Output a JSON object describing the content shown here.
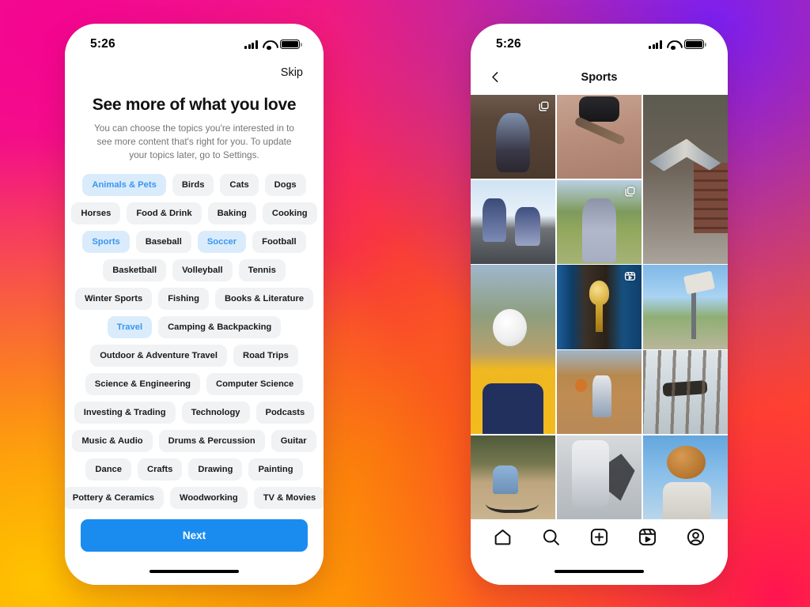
{
  "background": {
    "gradient_colors": [
      "#7b1ff0",
      "#f5058f",
      "#ff1450",
      "#ff9500",
      "#ffc200"
    ]
  },
  "theme": {
    "accent_blue": "#1a8cf0",
    "chip_selected_bg": "#daecfb",
    "chip_selected_text": "#3a96f2",
    "chip_bg": "#f1f2f3",
    "chip_text": "#1a1a1c"
  },
  "left_phone": {
    "status_bar": {
      "time": "5:26",
      "signal_icon": "cellular-bars-icon",
      "wifi_icon": "wifi-icon",
      "battery_icon": "battery-icon"
    },
    "skip_label": "Skip",
    "headline": "See more of what you love",
    "subtext": "You can choose the topics you're interested in to see more content that's right for you. To update your topics later, go to Settings.",
    "topic_rows": [
      [
        {
          "label": "Animals & Pets",
          "selected": true
        },
        {
          "label": "Birds",
          "selected": false
        },
        {
          "label": "Cats",
          "selected": false
        },
        {
          "label": "Dogs",
          "selected": false
        }
      ],
      [
        {
          "label": "Horses",
          "selected": false
        },
        {
          "label": "Food & Drink",
          "selected": false
        },
        {
          "label": "Baking",
          "selected": false
        },
        {
          "label": "Cooking",
          "selected": false
        }
      ],
      [
        {
          "label": "Sports",
          "selected": true
        },
        {
          "label": "Baseball",
          "selected": false
        },
        {
          "label": "Soccer",
          "selected": true
        },
        {
          "label": "Football",
          "selected": false
        }
      ],
      [
        {
          "label": "Basketball",
          "selected": false
        },
        {
          "label": "Volleyball",
          "selected": false
        },
        {
          "label": "Tennis",
          "selected": false
        }
      ],
      [
        {
          "label": "Winter Sports",
          "selected": false
        },
        {
          "label": "Fishing",
          "selected": false
        },
        {
          "label": "Books & Literature",
          "selected": false
        }
      ],
      [
        {
          "label": "Travel",
          "selected": true
        },
        {
          "label": "Camping & Backpacking",
          "selected": false
        }
      ],
      [
        {
          "label": "Outdoor & Adventure Travel",
          "selected": false
        },
        {
          "label": "Road Trips",
          "selected": false
        }
      ],
      [
        {
          "label": "Science & Engineering",
          "selected": false
        },
        {
          "label": "Computer Science",
          "selected": false
        }
      ],
      [
        {
          "label": "Investing & Trading",
          "selected": false
        },
        {
          "label": "Technology",
          "selected": false
        },
        {
          "label": "Podcasts",
          "selected": false
        }
      ],
      [
        {
          "label": "Music & Audio",
          "selected": false
        },
        {
          "label": "Drums & Percussion",
          "selected": false
        },
        {
          "label": "Guitar",
          "selected": false
        }
      ],
      [
        {
          "label": "Dance",
          "selected": false
        },
        {
          "label": "Crafts",
          "selected": false
        },
        {
          "label": "Drawing",
          "selected": false
        },
        {
          "label": "Painting",
          "selected": false
        }
      ],
      [
        {
          "label": "Pottery & Ceramics",
          "selected": false
        },
        {
          "label": "Woodworking",
          "selected": false
        },
        {
          "label": "TV & Movies",
          "selected": false
        }
      ]
    ],
    "next_label": "Next"
  },
  "right_phone": {
    "status_bar": {
      "time": "5:26",
      "signal_icon": "cellular-bars-icon",
      "wifi_icon": "wifi-icon",
      "battery_icon": "battery-icon"
    },
    "nav": {
      "back_icon": "chevron-left-icon",
      "title": "Sports"
    },
    "grid": [
      {
        "name": "post-porch-sitting",
        "art": "p-porch",
        "tall": false,
        "badge": "carousel-icon"
      },
      {
        "name": "post-skateboard-trick",
        "art": "p-skate",
        "tall": false,
        "badge": null
      },
      {
        "name": "post-stairs-split-jump",
        "art": "p-jump",
        "tall": true,
        "badge": null
      },
      {
        "name": "post-skatepark-pair",
        "art": "p-skatepark",
        "tall": false,
        "badge": null
      },
      {
        "name": "post-field-portrait",
        "art": "p-field",
        "tall": false,
        "badge": "carousel-icon"
      },
      {
        "name": "post-soccer-header",
        "art": "p-soccer",
        "tall": true,
        "badge": null
      },
      {
        "name": "post-trophy",
        "art": "p-trophy",
        "tall": false,
        "badge": "reels-icon"
      },
      {
        "name": "post-basketball-dunk",
        "art": "p-hoop",
        "tall": false,
        "badge": null
      },
      {
        "name": "post-basketball-court",
        "art": "p-bball",
        "tall": false,
        "badge": null
      },
      {
        "name": "post-forest-balance",
        "art": "p-forest",
        "tall": false,
        "badge": null
      },
      {
        "name": "post-bmx-rider",
        "art": "p-bike",
        "tall": false,
        "badge": null
      },
      {
        "name": "post-skater-shadow",
        "art": "p-shadow",
        "tall": false,
        "badge": null
      },
      {
        "name": "post-basketball-face",
        "art": "p-basketball",
        "tall": false,
        "badge": null
      }
    ],
    "tabbar": [
      {
        "name": "tab-home",
        "icon": "home-icon"
      },
      {
        "name": "tab-search",
        "icon": "search-icon"
      },
      {
        "name": "tab-create",
        "icon": "plus-square-icon"
      },
      {
        "name": "tab-reels",
        "icon": "reels-icon"
      },
      {
        "name": "tab-profile",
        "icon": "profile-icon"
      }
    ]
  }
}
